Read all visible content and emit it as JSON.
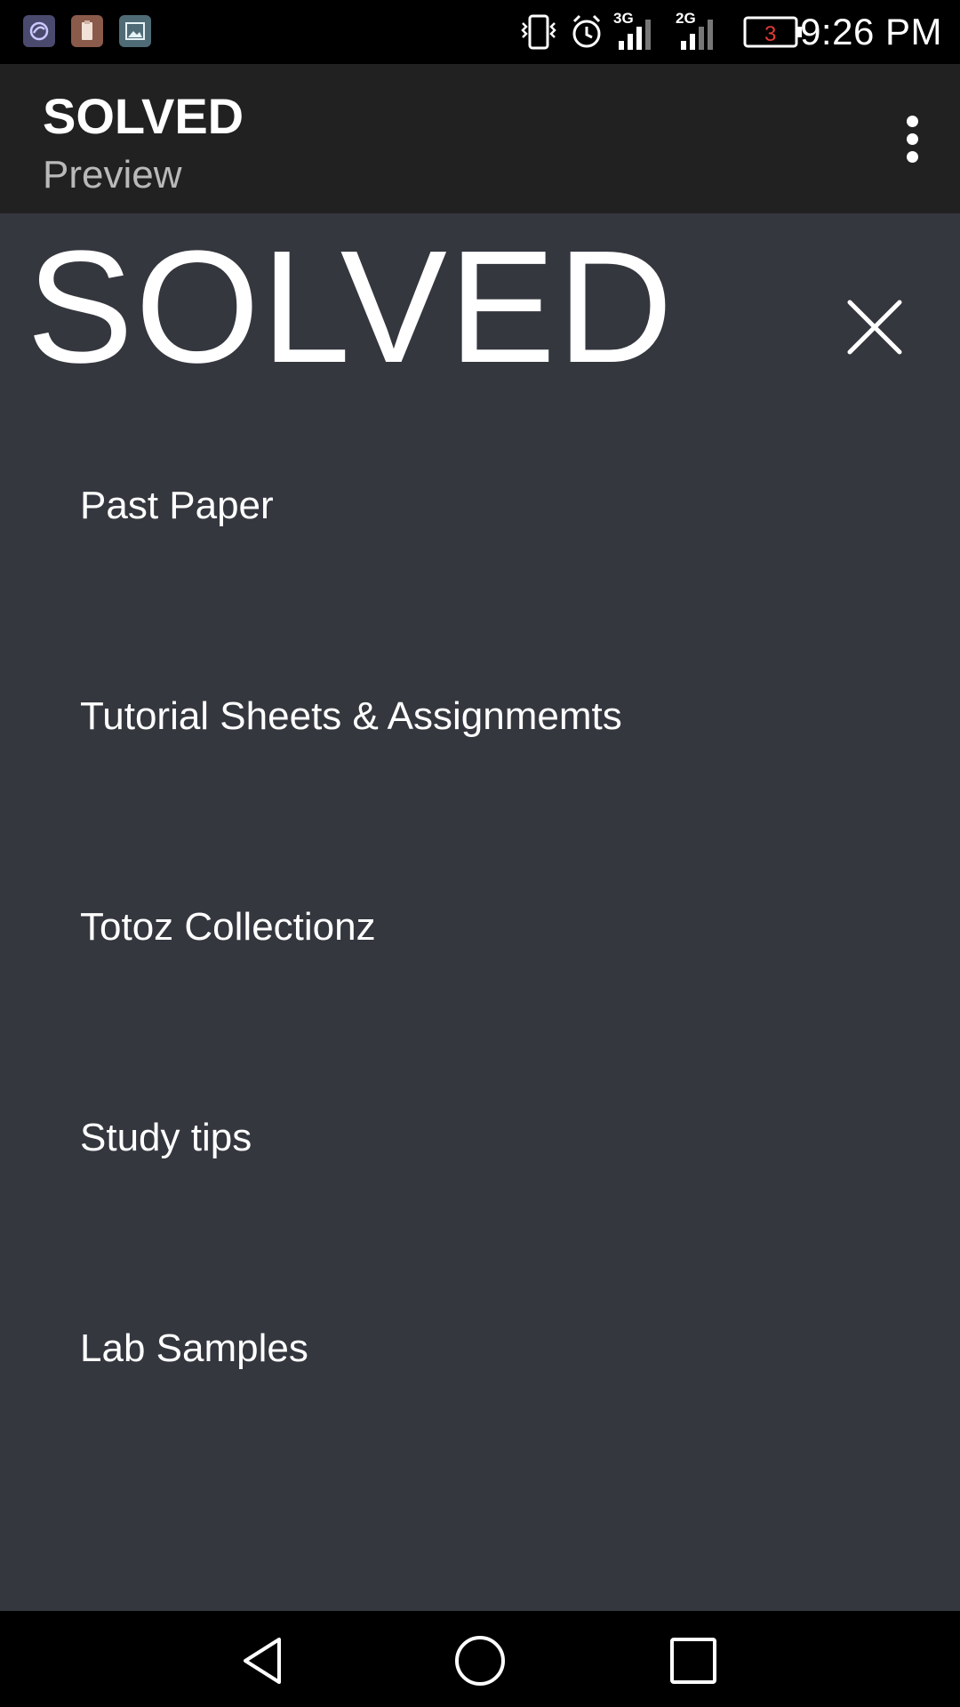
{
  "status_bar": {
    "time": "9:26 PM",
    "battery_level": "3",
    "network_1": "3G",
    "network_2": "2G",
    "notification_icons": [
      "app-notification-icon",
      "clipboard-icon",
      "gallery-icon"
    ],
    "status_icons": [
      "vibrate-icon",
      "alarm-icon",
      "signal-3g-icon",
      "signal-2g-icon",
      "battery-icon"
    ]
  },
  "toolbar": {
    "title": "SOLVED",
    "subtitle": "Preview",
    "overflow_icon": "more-vert-icon"
  },
  "menu": {
    "brand": "SOLVED",
    "close_icon": "close-icon",
    "items": [
      {
        "label": "Past Paper"
      },
      {
        "label": "Tutorial Sheets & Assignmemts"
      },
      {
        "label": "Totoz Collectionz"
      },
      {
        "label": "Study tips"
      },
      {
        "label": "Lab Samples"
      }
    ]
  },
  "nav_bar": {
    "back_icon": "back-icon",
    "home_icon": "home-icon",
    "recents_icon": "recents-icon"
  },
  "colors": {
    "status_bar_bg": "#000000",
    "toolbar_bg": "#212121",
    "menu_bg": "#35373f",
    "text_primary": "#ffffff",
    "text_secondary": "#b9b9b9",
    "battery_low": "#e53935"
  }
}
